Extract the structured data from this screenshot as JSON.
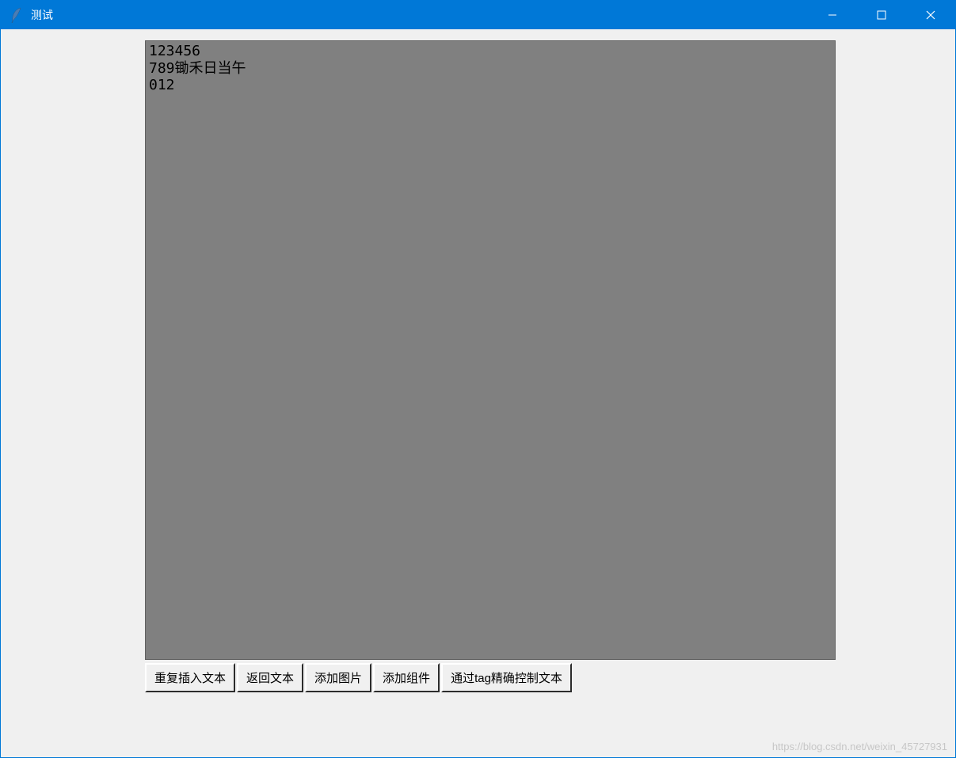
{
  "window": {
    "title": "测试",
    "icon_name": "tk-feather-icon"
  },
  "titlebar_controls": {
    "minimize": "minimize",
    "maximize": "maximize",
    "close": "close"
  },
  "text_widget": {
    "content": "123456\n789锄禾日当午\n012"
  },
  "buttons": {
    "btn1": "重复插入文本",
    "btn2": "返回文本",
    "btn3": "添加图片",
    "btn4": "添加组件",
    "btn5": "通过tag精确控制文本"
  },
  "watermark": "https://blog.csdn.net/weixin_45727931"
}
